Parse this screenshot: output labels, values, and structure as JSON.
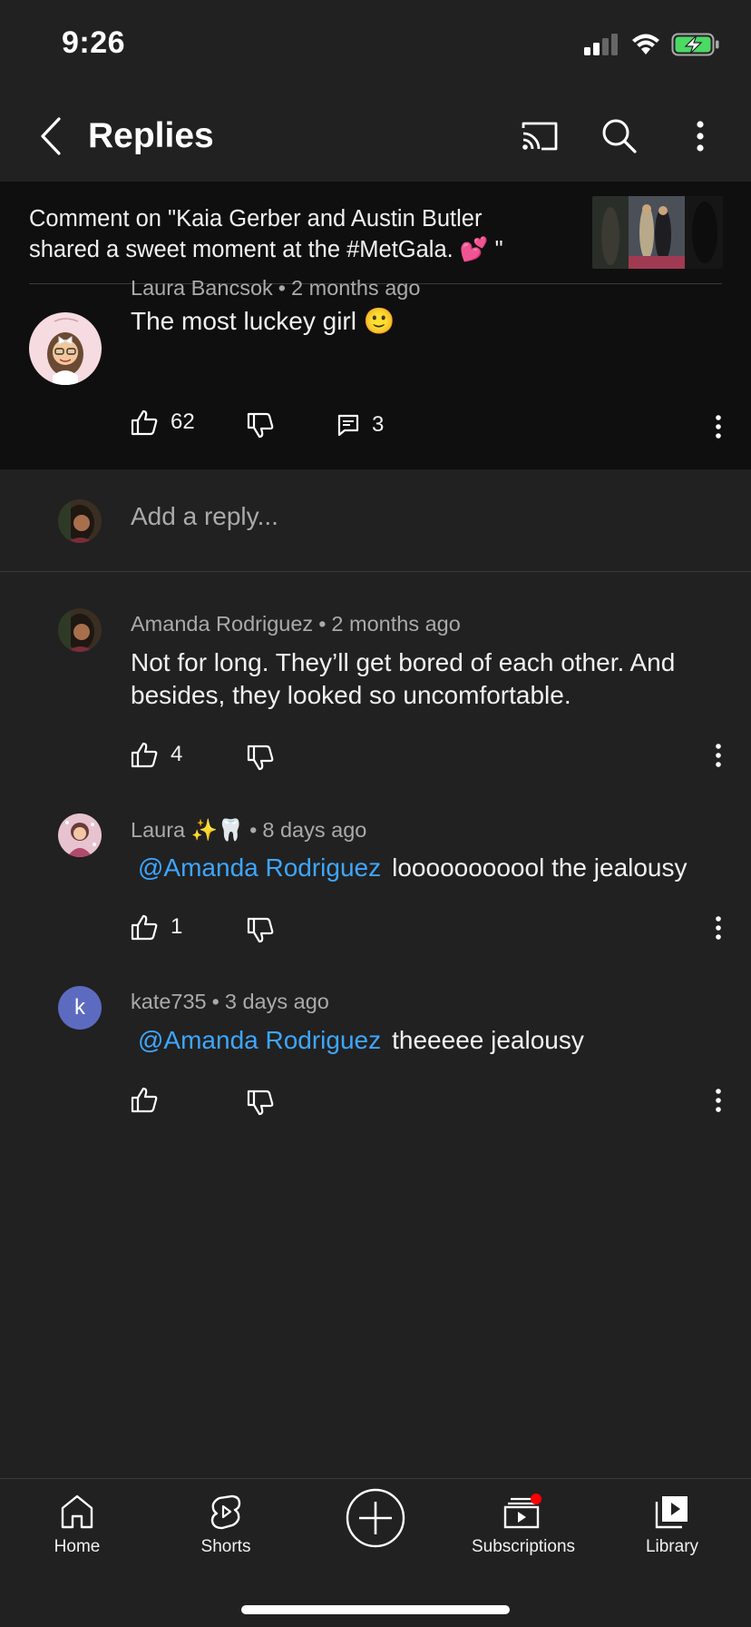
{
  "status_bar": {
    "time": "9:26"
  },
  "header": {
    "title": "Replies"
  },
  "context": {
    "text": "Comment on \"Kaia Gerber and Austin Butler shared a sweet moment at the #MetGala. 💕 \""
  },
  "top_comment": {
    "author": "Laura Bancsok",
    "time": "2 months ago",
    "text": "The most luckey girl 🙂",
    "likes": "62",
    "replies": "3"
  },
  "reply_input": {
    "placeholder": "Add a reply..."
  },
  "replies": [
    {
      "author": "Amanda Rodriguez",
      "time": "2 months ago",
      "text": "Not for long. They’ll get bored of each other. And besides, they looked so uncomfortable.",
      "likes": "4"
    },
    {
      "author": "Laura ✨🦷",
      "time": "8 days ago",
      "mention": "@Amanda Rodriguez",
      "text": "looooooooool the jealousy",
      "likes": "1"
    },
    {
      "author": "kate735",
      "avatar_letter": "k",
      "time": "3 days ago",
      "mention": "@Amanda Rodriguez",
      "text": "theeeee jealousy",
      "likes": ""
    }
  ],
  "nav": {
    "home": "Home",
    "shorts": "Shorts",
    "subscriptions": "Subscriptions",
    "library": "Library"
  },
  "colors": {
    "background": "#212121",
    "context_background": "#0f0f0f",
    "mention": "#3ea6ff",
    "notification_dot": "#ff0000",
    "kate_avatar": "#5c6bc0",
    "battery_green": "#4cd964"
  },
  "icons": [
    "back-icon",
    "cast-icon",
    "search-icon",
    "more-vert-icon",
    "like-icon",
    "dislike-icon",
    "reply-icon",
    "home-icon",
    "shorts-icon",
    "create-icon",
    "subscriptions-icon",
    "library-icon"
  ]
}
